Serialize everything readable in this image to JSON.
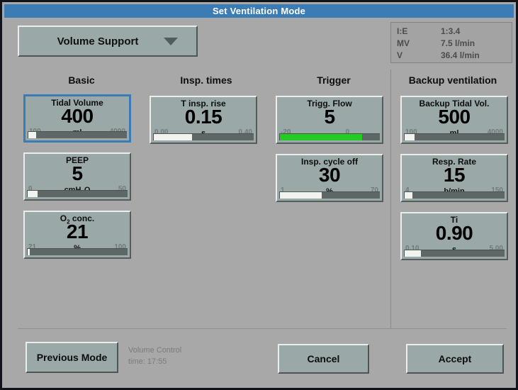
{
  "window": {
    "title": "Set Ventilation Mode"
  },
  "mode_select": {
    "label": "Volume Support",
    "caret_icon": "chevron-down-icon"
  },
  "info_panel": {
    "rows": [
      {
        "key": "I:E",
        "value": "1:3.4"
      },
      {
        "key": "MV",
        "value": "7.5 l/min"
      },
      {
        "key": "V",
        "value": "36.4 l/min"
      }
    ]
  },
  "columns": [
    {
      "header": "Basic"
    },
    {
      "header": "Insp. times"
    },
    {
      "header": "Trigger"
    },
    {
      "header": "Backup ventilation"
    }
  ],
  "parameters": {
    "tidal_volume": {
      "label": "Tidal Volume",
      "value": "400",
      "unit": "ml",
      "min": "100",
      "max": "4000",
      "fill_percent": 8,
      "selected": true
    },
    "peep": {
      "label": "PEEP",
      "value": "5",
      "unit_pre": "cmH",
      "unit_sub": "2",
      "unit_post": "O",
      "min": "0",
      "max": "50",
      "fill_percent": 10
    },
    "o2_conc": {
      "label_pre": "O",
      "label_sub": "2",
      "label_post": " conc.",
      "value": "21",
      "unit": "%",
      "min": "21",
      "max": "100",
      "fill_percent": 2
    },
    "t_insp_rise": {
      "label": "T insp. rise",
      "value": "0.15",
      "unit": "s",
      "min": "0.00",
      "max": "0.40",
      "fill_percent": 38
    },
    "trigg_flow": {
      "label": "Trigg. Flow",
      "value": "5",
      "unit": "",
      "min": "-20",
      "max": "0",
      "fill_percent": 82,
      "fill_color": "#22cc22"
    },
    "insp_cycle_off": {
      "label": "Insp. cycle off",
      "value": "30",
      "unit": "%",
      "min": "1",
      "max": "70",
      "fill_percent": 42
    },
    "backup_tidal_vol": {
      "label": "Backup Tidal Vol.",
      "value": "500",
      "unit": "ml",
      "min": "100",
      "max": "4000",
      "fill_percent": 10
    },
    "resp_rate": {
      "label": "Resp. Rate",
      "value": "15",
      "unit": "b/min",
      "min": "4",
      "max": "150",
      "fill_percent": 8
    },
    "ti": {
      "label": "Ti",
      "value": "0.90",
      "unit": "s",
      "min": "0.10",
      "max": "5.00",
      "fill_percent": 16
    }
  },
  "footer": {
    "previous_mode": "Previous Mode",
    "status_mode": "Volume Control",
    "status_time": "time: 17:55",
    "cancel": "Cancel",
    "accept": "Accept"
  },
  "theme": {
    "title_bar": "#3c7cb4",
    "window_bg": "#a8a8a8",
    "box_bg": "#9aa8a8",
    "selection": "#3c7cb4",
    "trigger_green": "#22cc22"
  }
}
